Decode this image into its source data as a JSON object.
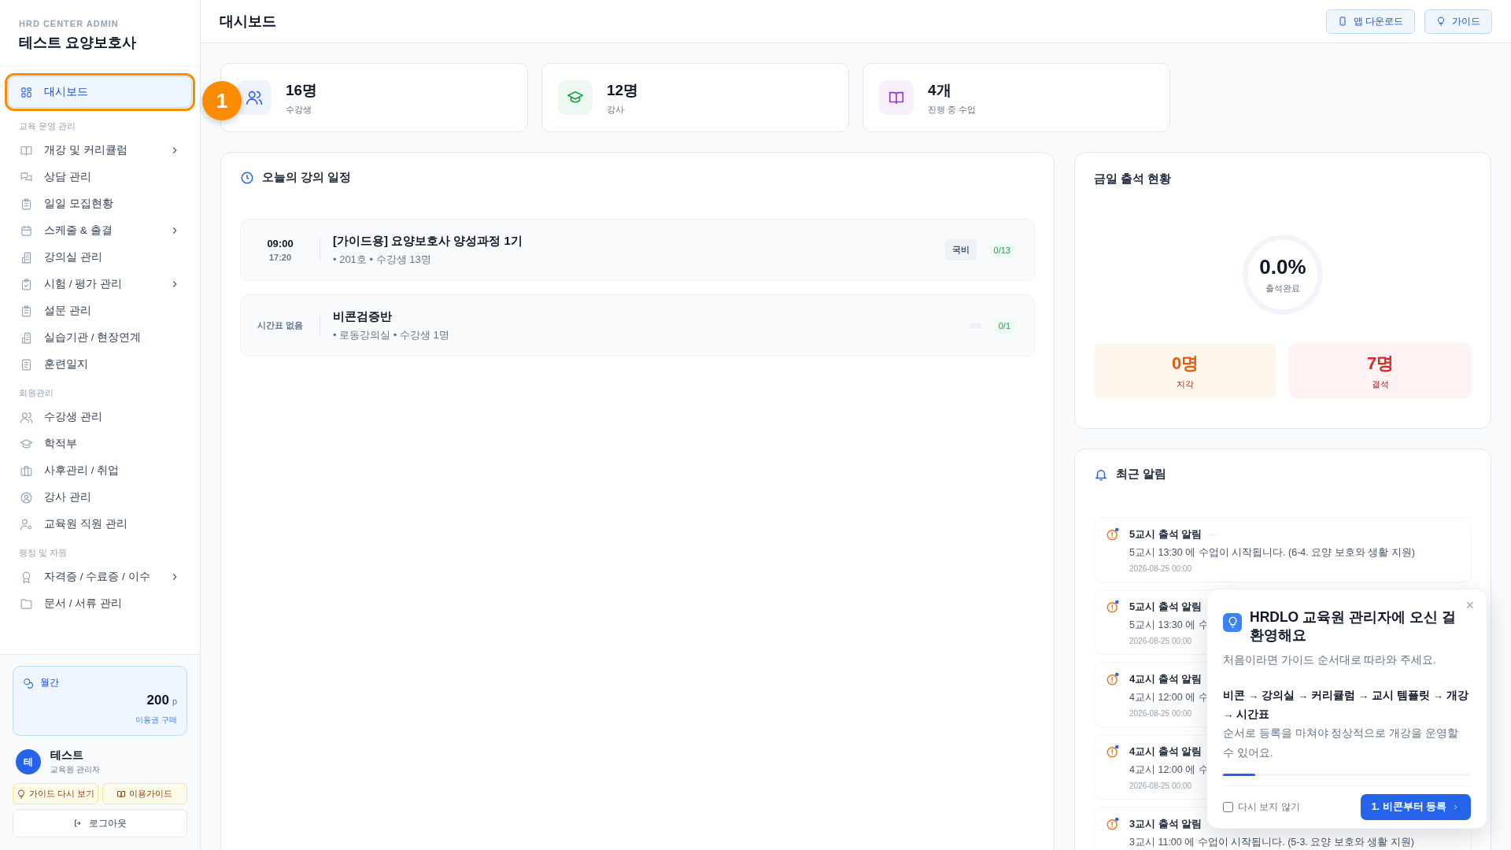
{
  "sidebar": {
    "brand_caption": "HRD CENTER ADMIN",
    "brand_title": "테스트 요양보호사",
    "groups": [
      {
        "items": [
          {
            "label": "대시보드",
            "selected": true,
            "highlighted": true,
            "expandable": false
          }
        ]
      },
      {
        "label": "교육 운영 관리",
        "items": [
          {
            "label": "개강 및 커리큘럼",
            "selected": false,
            "highlighted": false,
            "expandable": true
          },
          {
            "label": "상담 관리",
            "selected": false,
            "highlighted": false,
            "expandable": false
          },
          {
            "label": "일일 모집현황",
            "selected": false,
            "highlighted": false,
            "expandable": false
          },
          {
            "label": "스케줄 & 출결",
            "selected": false,
            "highlighted": false,
            "expandable": true
          },
          {
            "label": "강의실 관리",
            "selected": false,
            "highlighted": false,
            "expandable": false
          },
          {
            "label": "시험 / 평가 관리",
            "selected": false,
            "highlighted": false,
            "expandable": true
          },
          {
            "label": "설문 관리",
            "selected": false,
            "highlighted": false,
            "expandable": false
          },
          {
            "label": "실습기관 / 현장연계",
            "selected": false,
            "highlighted": false,
            "expandable": false
          },
          {
            "label": "훈련일지",
            "selected": false,
            "highlighted": false,
            "expandable": false
          }
        ]
      },
      {
        "label": "회원관리",
        "items": [
          {
            "label": "수강생 관리",
            "selected": false,
            "highlighted": false,
            "expandable": false
          },
          {
            "label": "학적부",
            "selected": false,
            "highlighted": false,
            "expandable": false
          },
          {
            "label": "사후관리 / 취업",
            "selected": false,
            "highlighted": false,
            "expandable": false
          },
          {
            "label": "강사 관리",
            "selected": false,
            "highlighted": false,
            "expandable": false
          },
          {
            "label": "교육원 직원 관리",
            "selected": false,
            "highlighted": false,
            "expandable": false
          }
        ]
      },
      {
        "label": "행정 및 자원",
        "items": [
          {
            "label": "자격증 / 수료증 / 이수",
            "selected": false,
            "highlighted": false,
            "expandable": true
          },
          {
            "label": "문서 / 서류 관리",
            "selected": false,
            "highlighted": false,
            "expandable": false
          }
        ]
      }
    ],
    "plan": {
      "name": "월간",
      "points": "200",
      "unit": "p",
      "link": "이용권 구매"
    },
    "user": {
      "initial": "테",
      "name": "테스트",
      "role": "교육원 관리자"
    },
    "guide_buttons": [
      "가이드 다시 보기",
      "이용가이드"
    ],
    "logout": "로그아웃"
  },
  "guide_step_badge": "1",
  "header": {
    "title": "대시보드",
    "buttons": [
      "앱 다운로드",
      "가이드"
    ]
  },
  "stats": [
    {
      "value": "16명",
      "label": "수강생",
      "color": "#2563eb"
    },
    {
      "value": "12명",
      "label": "강사",
      "color": "#16a34a"
    },
    {
      "value": "4개",
      "label": "진행 중 수업",
      "color": "#9333ea"
    }
  ],
  "schedule": {
    "title": "오늘의 강의 일정",
    "rows": [
      {
        "kind": "timed",
        "start": "09:00",
        "end": "17:20",
        "title": "[가이드용] 요양보호사 양성과정 1기",
        "detail": "• 201호 • 수강생 13명",
        "tag": "국비",
        "count": "0/13"
      },
      {
        "kind": "untimed",
        "time_note": "시간표 없음",
        "title": "비콘검증반",
        "detail": "• 로동강의실 • 수강생 1명",
        "count": "0/1"
      }
    ]
  },
  "attendance": {
    "title": "금일 출석 현황",
    "rate": "0.0%",
    "rate_label": "출석완료",
    "level": 0,
    "boxes": [
      {
        "kind": "late",
        "value": "0명",
        "label": "지각"
      },
      {
        "kind": "absent",
        "value": "7명",
        "label": "결석"
      }
    ]
  },
  "notifications": {
    "title": "최근 알림",
    "items": [
      {
        "title": "5교시 출석 알림",
        "unread": true,
        "message": "5교시 13:30 에 수업이 시작됩니다. (6-4. 요양 보호와 생활 지원)",
        "date": "2026-08-25 00:00"
      },
      {
        "title": "5교시 출석 알림",
        "unread": true,
        "message": "5교시 13:30 에 수",
        "date": "2026-08-25 00:00"
      },
      {
        "title": "4교시 출석 알림",
        "unread": true,
        "message": "4교시 12:00 에 수",
        "date": "2026-08-25 00:00"
      },
      {
        "title": "4교시 출석 알림",
        "unread": true,
        "message": "4교시 12:00 에 수",
        "date": "2026-08-25 00:00"
      },
      {
        "title": "3교시 출석 알림",
        "unread": true,
        "message": "3교시 11:00 에 수업이 시작됩니다. (5-3. 요양 보호와 생활 지원)"
      }
    ]
  },
  "guide_popup": {
    "title": "HRDLO 교육원 관리자에 오신 걸 환영해요",
    "intro": "처음이라면 가이드 순서대로 따라와 주세요.",
    "steps": "비콘 → 강의실 → 커리큘럼 → 교시 템플릿 → 개강 → 시간표",
    "note": "순서로 등록을 마쳐야 정상적으로 개강을 운영할 수 있어요.",
    "level": 0.13,
    "dont_show": {
      "label": "다시 보지 않기",
      "checked": false
    },
    "button": "1. 비콘부터 등록",
    "close": "×"
  }
}
